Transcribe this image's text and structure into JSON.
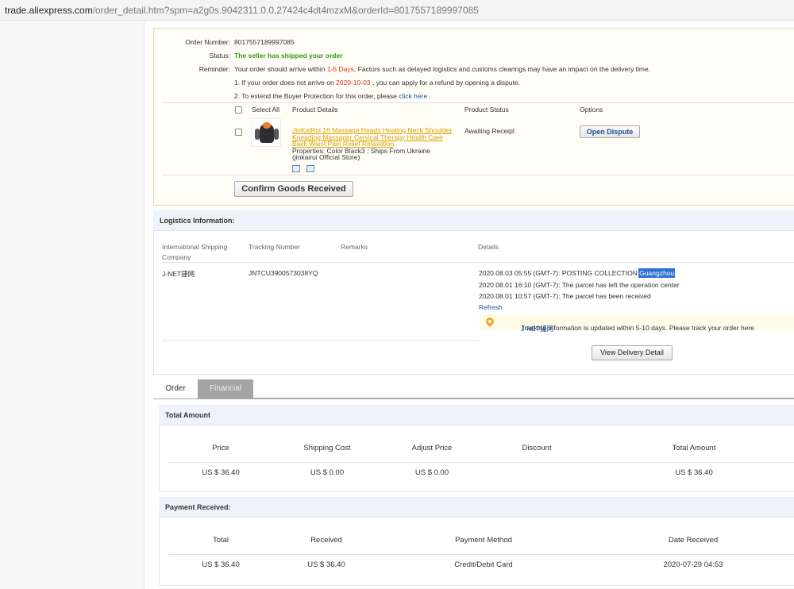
{
  "browser": {
    "url_host": "trade.aliexpress.com",
    "url_rest": "/order_detail.htm?spm=a2g0s.9042311.0.0.27424c4dt4mzxM&orderId=8017557189997085"
  },
  "order": {
    "number_label": "Order Number:",
    "number": "8017557189997085",
    "status_label": "Status:",
    "status": "The seller has shipped your order",
    "reminder_label": "Reminder:",
    "reminder_pre": "Your order should arrive within ",
    "reminder_days": "1-5 Days",
    "reminder_post": ", Factors such as delayed logistics and customs clearings may have an impact on the delivery time.",
    "note1_pre": "1. If your order does not arrive on ",
    "note1_date": "2020-10-03",
    "note1_post": " , you can apply for a refund by opening a dispute.",
    "note2_pre": "2. To extend the Buyer Protection for this order, please ",
    "note2_link": "click here",
    "note2_post": " .",
    "cols": {
      "select_all": "Select All",
      "details": "Product Details",
      "status": "Product Status",
      "options": "Options"
    },
    "product": {
      "title": "JinKaiRui 16 Massage Heads Heating Neck Shoulder Kneading Massager Cervical Therapy Health Care Back Waist Pain Relief Relaxation",
      "properties_line1": "Properties: Color Black3    ; Ships From Ukraine",
      "properties_line2": "(jinkairui Official Store)",
      "status": "Awaiting Receipt",
      "dispute_btn": "Open Dispute"
    },
    "confirm_btn": "Confirm Goods Received"
  },
  "logistics": {
    "heading": "Logistics Information:",
    "col_company_1": "International Shipping",
    "col_company_2": "Company",
    "col_tracking": "Tracking Number",
    "col_remarks": "Remarks",
    "col_details": "Details",
    "company": "J-NET捷网",
    "tracking": "JNTCU3900573038YQ",
    "events": [
      {
        "pre": "2020.08.03 05:55 (GMT-7): POSTING COLLECTION ",
        "hl": "Guangzhou"
      },
      {
        "pre": "2020.08.01 16:10 (GMT-7): The parcel has left the operation center",
        "hl": ""
      },
      {
        "pre": "2020.08.01 10:57 (GMT-7): The parcel has been received",
        "hl": ""
      }
    ],
    "refresh": "Refresh",
    "note_pre": "Tracking information is updated within 5-10 days. Please track your order here ",
    "note_link": "J-NET捷网",
    "delivery_btn": "View Delivery Detail"
  },
  "tabs": {
    "order": "Order",
    "financial": "Financial"
  },
  "total": {
    "heading": "Total Amount",
    "headers": [
      "Price",
      "Shipping Cost",
      "Adjust Price",
      "Discount",
      "Total Amount"
    ],
    "values": [
      "US $ 36.40",
      "US $ 0.00",
      "US $ 0.00",
      "",
      "US $ 36.40"
    ]
  },
  "payment": {
    "heading": "Payment Received:",
    "headers": [
      "Total",
      "Received",
      "Payment Method",
      "Date Received"
    ],
    "values": [
      "US $ 36.40",
      "US $ 36.40",
      "Credit/Debit Card",
      "2020-07-29 04:53"
    ]
  }
}
